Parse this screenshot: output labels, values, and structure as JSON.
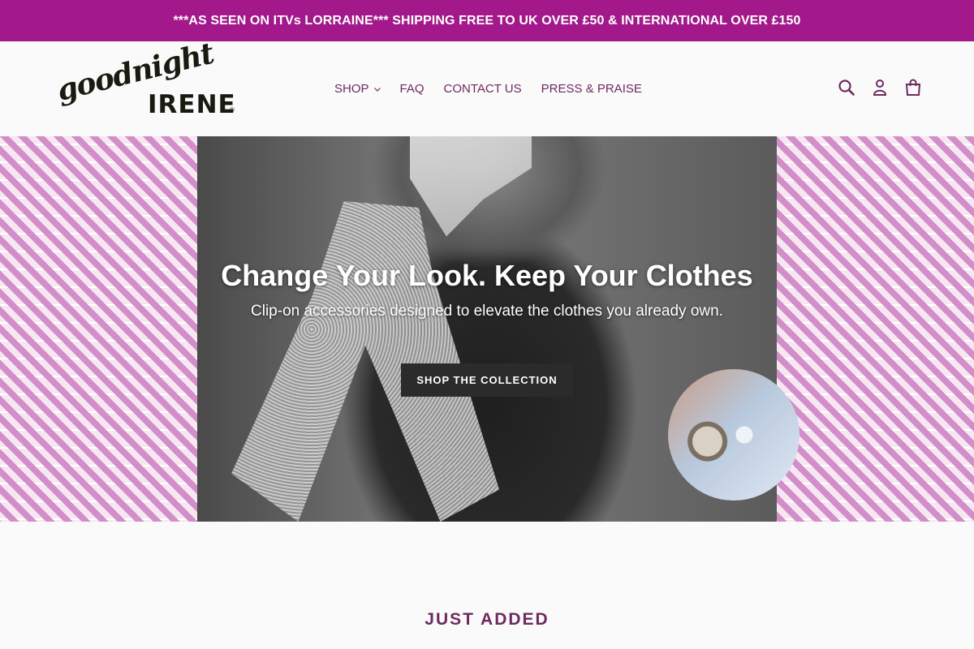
{
  "announcement": {
    "text": "***AS SEEN ON ITVs LORRAINE*** SHIPPING FREE TO UK OVER £50 & INTERNATIONAL OVER £150"
  },
  "header": {
    "logo_script": "goodnight",
    "logo_main": "IRENE",
    "logo_reg": "®",
    "nav": [
      {
        "label": "SHOP",
        "has_dropdown": true
      },
      {
        "label": "FAQ"
      },
      {
        "label": "CONTACT US"
      },
      {
        "label": "PRESS & PRAISE"
      }
    ],
    "icons": [
      "search-icon",
      "account-icon",
      "cart-icon"
    ]
  },
  "hero": {
    "title": "Change Your Look. Keep Your Clothes",
    "subtitle": "Clip-on accessories designed to elevate the clothes you already own.",
    "cta_label": "SHOP THE COLLECTION"
  },
  "section": {
    "title": "JUST ADDED"
  },
  "colors": {
    "brand": "#a3188a",
    "nav_text": "#6e2a5f",
    "pattern": "#d18ec8",
    "cta_bg": "#2b2b2b"
  }
}
